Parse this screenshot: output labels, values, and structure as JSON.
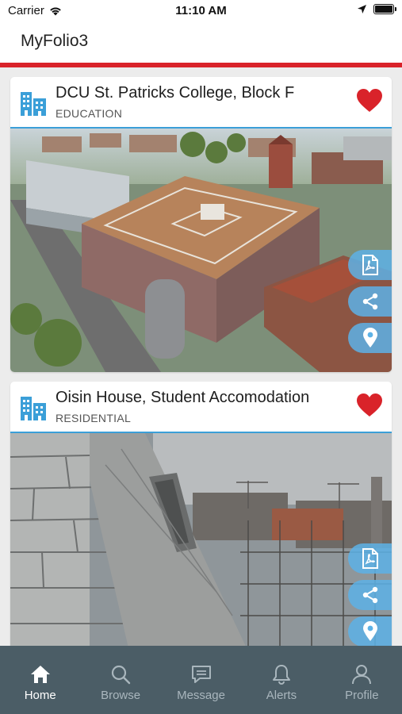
{
  "status_bar": {
    "carrier": "Carrier",
    "time": "11:10 AM"
  },
  "app": {
    "title": "MyFolio3",
    "accent_color": "#d9232a"
  },
  "projects": [
    {
      "title": "DCU St. Patricks College, Block F",
      "category": "EDUCATION",
      "favorited": true,
      "icon": "building-icon"
    },
    {
      "title": "Oisin House, Student Accomodation",
      "category": "RESIDENTIAL",
      "favorited": true,
      "icon": "building-icon"
    }
  ],
  "card_actions": [
    "pdf-icon",
    "share-icon",
    "location-pin-icon"
  ],
  "nav": {
    "active": "Home",
    "items": [
      {
        "label": "Home",
        "icon": "home-icon"
      },
      {
        "label": "Browse",
        "icon": "search-icon"
      },
      {
        "label": "Message",
        "icon": "message-icon"
      },
      {
        "label": "Alerts",
        "icon": "bell-icon"
      },
      {
        "label": "Profile",
        "icon": "person-icon"
      }
    ]
  },
  "colors": {
    "accent_blue": "#3b9fd8",
    "nav_background": "#4b5d66",
    "heart": "#d9232a"
  }
}
